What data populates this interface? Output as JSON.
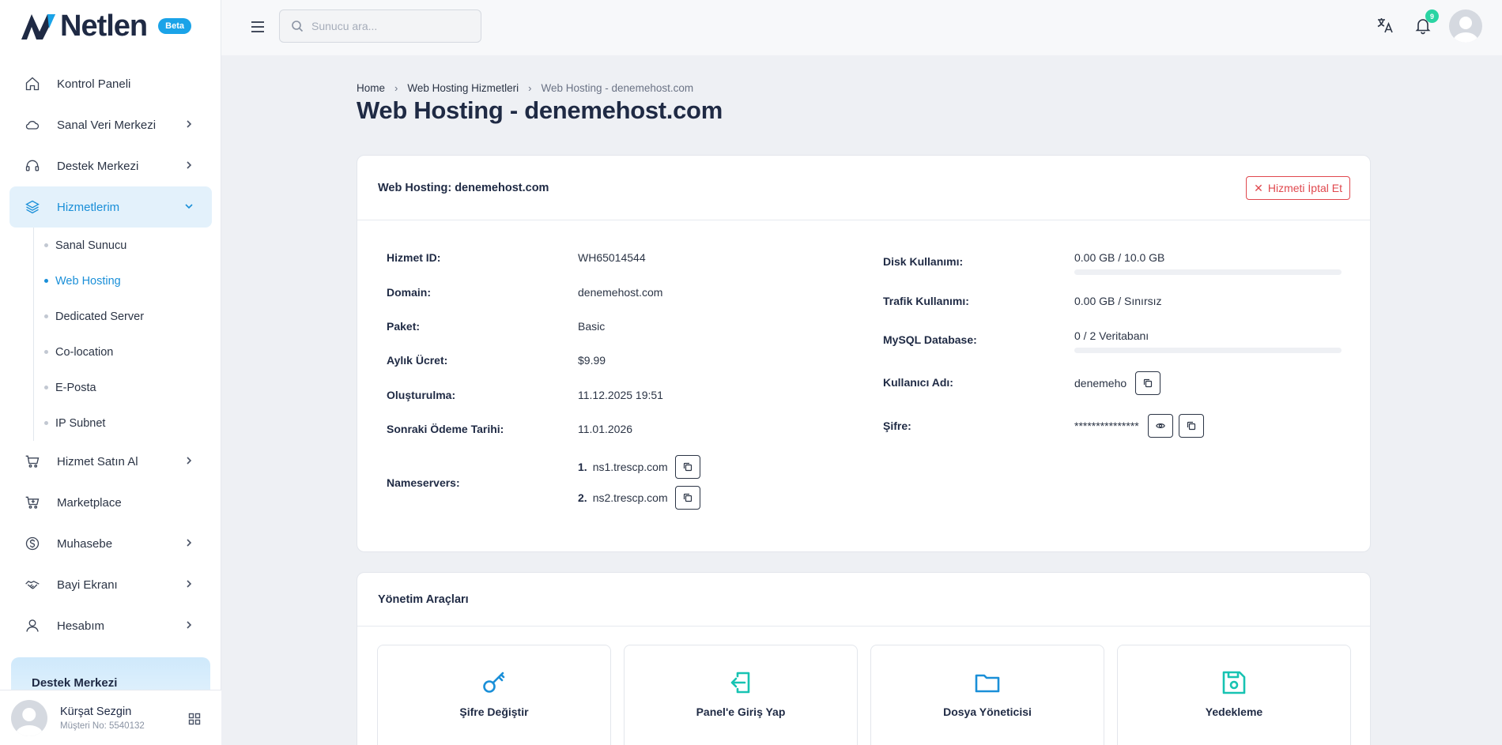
{
  "brand": {
    "name": "Netlen",
    "badge": "Beta"
  },
  "sidebar": {
    "items": [
      {
        "label": "Kontrol Paneli",
        "icon": "home-icon"
      },
      {
        "label": "Sanal Veri Merkezi",
        "icon": "cloud-icon"
      },
      {
        "label": "Destek Merkezi",
        "icon": "headset-icon"
      },
      {
        "label": "Hizmetlerim",
        "icon": "layers-icon"
      },
      {
        "label": "Hizmet Satın Al",
        "icon": "cart-icon"
      },
      {
        "label": "Marketplace",
        "icon": "cart-plus-icon"
      },
      {
        "label": "Muhasebe",
        "icon": "dollar-icon"
      },
      {
        "label": "Bayi Ekranı",
        "icon": "handshake-icon"
      },
      {
        "label": "Hesabım",
        "icon": "user-icon"
      }
    ],
    "subitems": [
      "Sanal Sunucu",
      "Web Hosting",
      "Dedicated Server",
      "Co-location",
      "E-Posta",
      "IP Subnet"
    ],
    "support_card": "Destek Merkezi",
    "user": {
      "name": "Kürşat Sezgin",
      "customer_no": "Müşteri No: 5540132"
    }
  },
  "topbar": {
    "search_placeholder": "Sunucu ara...",
    "notification_count": "9"
  },
  "breadcrumb": [
    "Home",
    "Web Hosting Hizmetleri",
    "Web Hosting - denemehost.com"
  ],
  "page_title": "Web Hosting - denemehost.com",
  "details_card": {
    "title": "Web Hosting: denemehost.com",
    "cancel_label": "Hizmeti İptal Et",
    "left": [
      {
        "key": "Hizmet ID:",
        "value": "WH65014544"
      },
      {
        "key": "Domain:",
        "value": "denemehost.com"
      },
      {
        "key": "Paket:",
        "value": "Basic"
      },
      {
        "key": "Aylık Ücret:",
        "value": "$9.99"
      },
      {
        "key": "Oluşturulma:",
        "value": "11.12.2025 19:51"
      },
      {
        "key": "Sonraki Ödeme Tarihi:",
        "value": "11.01.2026"
      }
    ],
    "nameservers_label": "Nameservers:",
    "nameservers": [
      {
        "num": "1.",
        "host": "ns1.trescp.com"
      },
      {
        "num": "2.",
        "host": "ns2.trescp.com"
      }
    ],
    "right": {
      "disk_label": "Disk Kullanımı:",
      "disk_value": "0.00 GB / 10.0 GB",
      "disk_percent": 0,
      "traffic_label": "Trafik Kullanımı:",
      "traffic_value": "0.00 GB / Sınırsız",
      "mysql_label": "MySQL Database:",
      "mysql_value": "0 / 2 Veritabanı",
      "mysql_percent": 0,
      "username_label": "Kullanıcı Adı:",
      "username_value": "denemeho",
      "password_label": "Şifre:",
      "password_value": "***************"
    }
  },
  "tools_card": {
    "title": "Yönetim Araçları",
    "tools": [
      {
        "label": "Şifre Değiştir",
        "icon": "key-icon"
      },
      {
        "label": "Panel'e Giriş Yap",
        "icon": "login-icon"
      },
      {
        "label": "Dosya Yöneticisi",
        "icon": "folder-icon"
      },
      {
        "label": "Yedekleme",
        "icon": "save-icon"
      }
    ]
  },
  "colors": {
    "accent": "#1a8fd8",
    "danger": "#e0484e",
    "tool_teal": "#17c3b2",
    "tool_blue": "#1a8fd8"
  }
}
